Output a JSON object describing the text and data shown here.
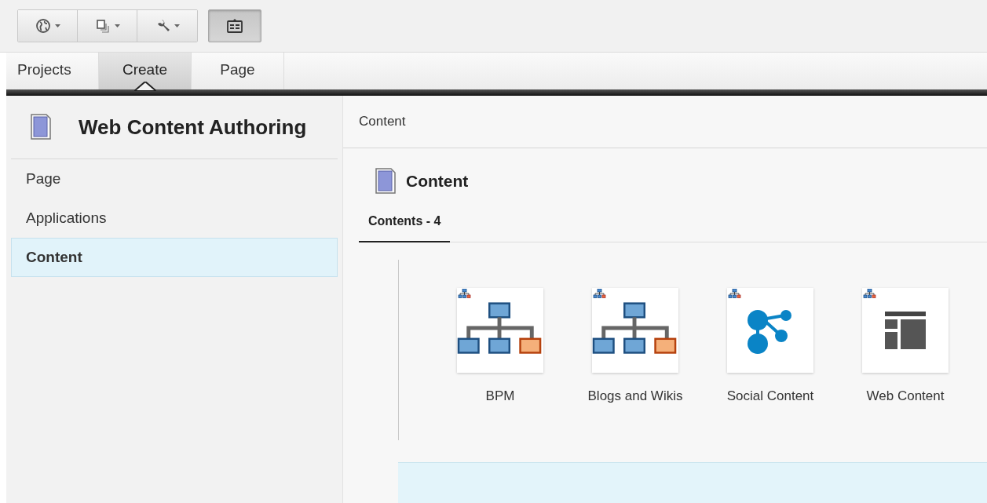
{
  "toolbar": {
    "buttons": [
      {
        "kind": "globe",
        "dropdown": true
      },
      {
        "kind": "pages",
        "dropdown": true
      },
      {
        "kind": "wrench",
        "dropdown": true
      }
    ],
    "toggle": {
      "kind": "panel",
      "on": true
    }
  },
  "tabs": [
    {
      "label": "Projects",
      "selected": false
    },
    {
      "label": "Create",
      "selected": true
    },
    {
      "label": "Page",
      "selected": false
    }
  ],
  "sidebar": {
    "title": "Web Content Authoring",
    "items": [
      {
        "label": "Page",
        "selected": false
      },
      {
        "label": "Applications",
        "selected": false
      },
      {
        "label": "Content",
        "selected": true
      }
    ]
  },
  "main": {
    "breadcrumb": "Content",
    "heading": "Content",
    "tabs": [
      {
        "label": "Contents - 4",
        "selected": true
      }
    ],
    "items": [
      {
        "label": "BPM",
        "kind": "hierarchy"
      },
      {
        "label": "Blogs and Wikis",
        "kind": "hierarchy"
      },
      {
        "label": "Social Content",
        "kind": "social"
      },
      {
        "label": "Web Content",
        "kind": "layout"
      }
    ]
  }
}
